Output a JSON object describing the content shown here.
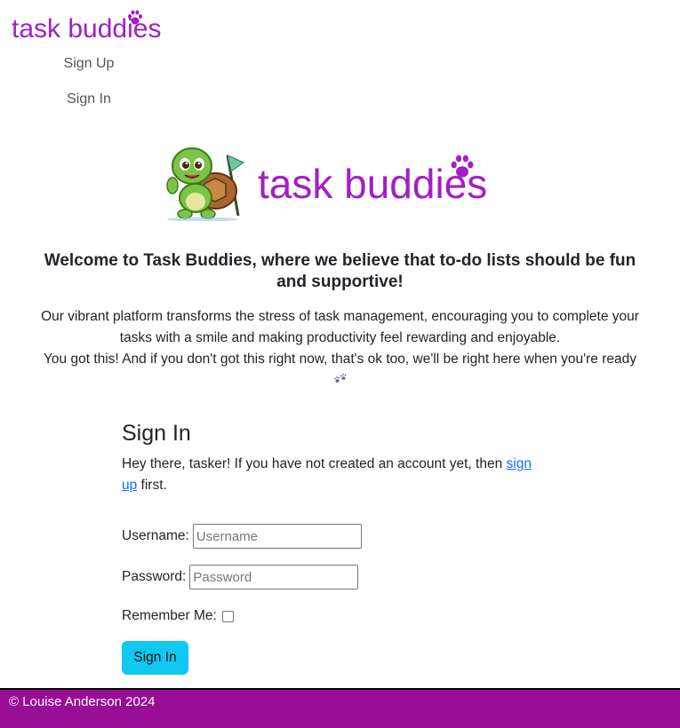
{
  "brand": {
    "name": "task buddies",
    "accent_color": "#a21fc4",
    "paw_icon": "paw-icon"
  },
  "nav": {
    "items": [
      {
        "label": "Sign Up"
      },
      {
        "label": "Sign In"
      }
    ]
  },
  "hero": {
    "title": "task buddies",
    "mascot": "turtle-with-flag"
  },
  "welcome": {
    "heading": "Welcome to Task Buddies, where we believe that to-do lists should be fun and supportive!",
    "paragraph1": "Our vibrant platform transforms the stress of task management, encouraging you to complete your tasks with a smile and making productivity feel rewarding and enjoyable.",
    "paragraph2": "You got this! And if you don't got this right now, that's ok too, we'll be right here when you're ready"
  },
  "signin": {
    "title": "Sign In",
    "intro_before": "Hey there, tasker! If you have not created an account yet, then ",
    "intro_link": "sign up",
    "intro_after": " first.",
    "username_label": "Username:",
    "username_placeholder": "Username",
    "username_value": "",
    "password_label": "Password:",
    "password_placeholder": "Password",
    "password_value": "",
    "remember_label": "Remember Me:",
    "remember_checked": false,
    "submit_label": "Sign In",
    "button_color": "#10c8f0"
  },
  "footer": {
    "text": "© Louise Anderson 2024",
    "background": "#970d96"
  }
}
